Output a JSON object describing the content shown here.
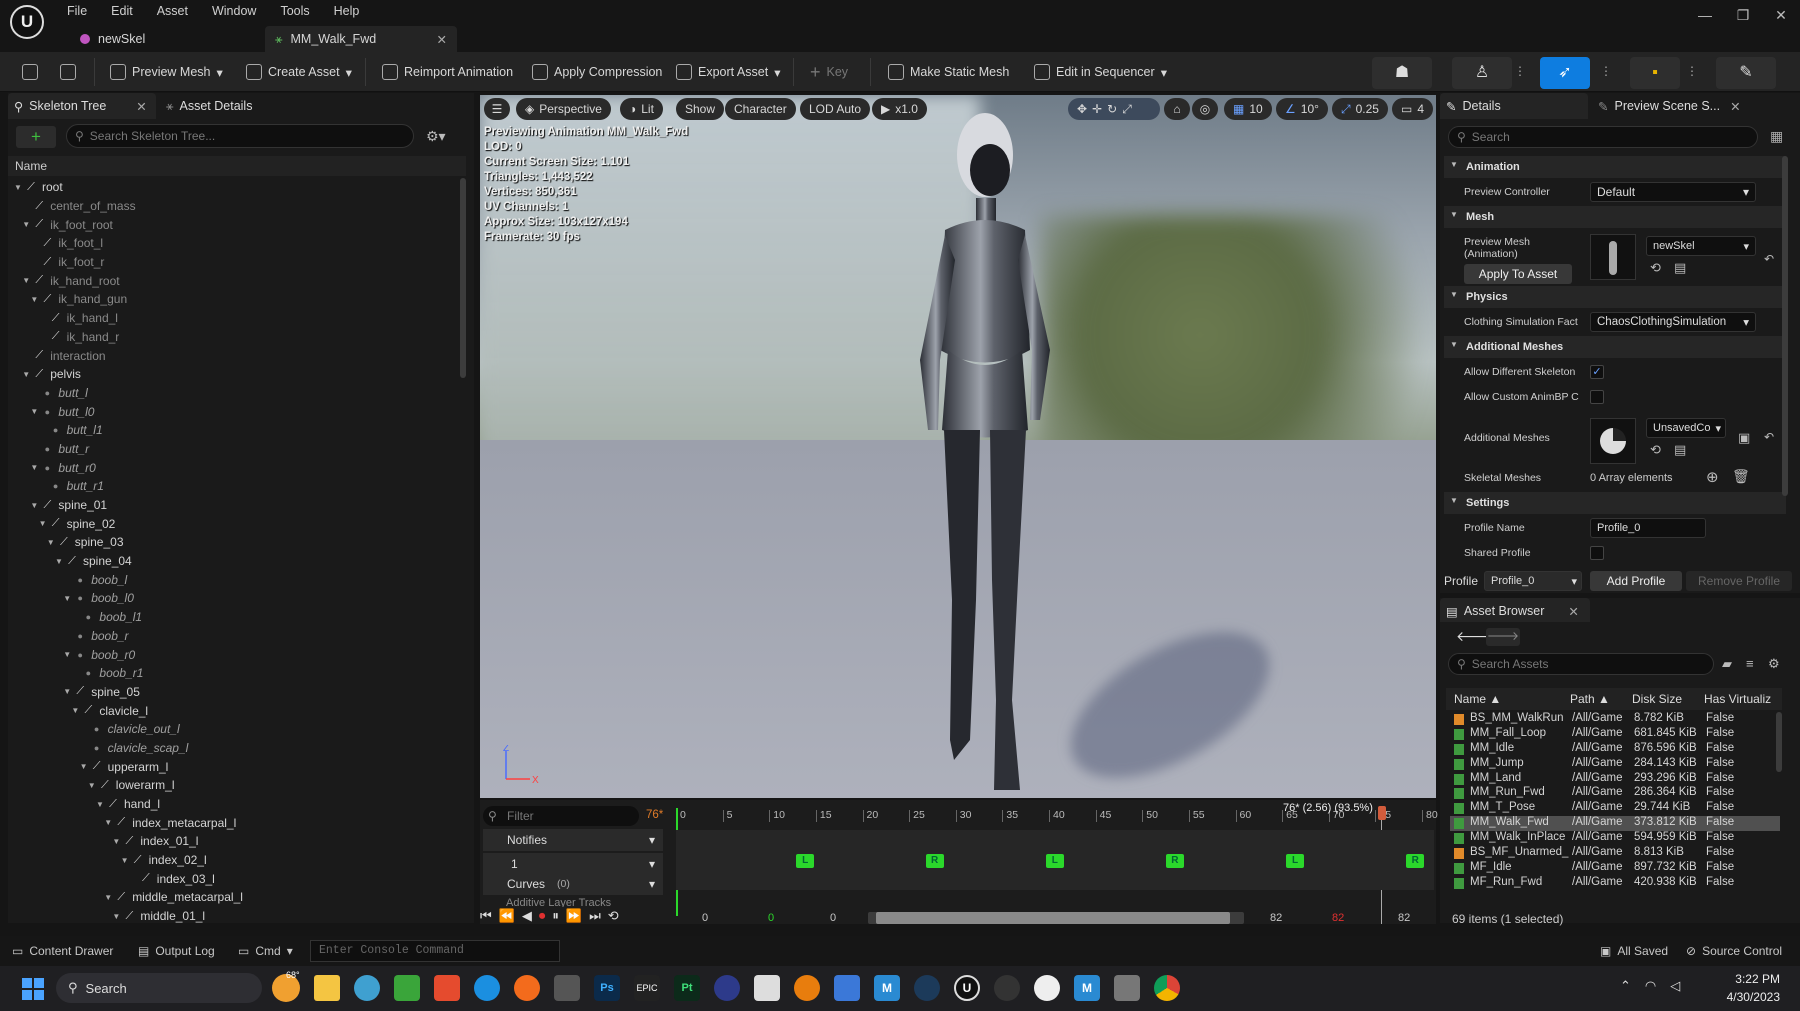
{
  "app": {
    "menus": [
      "File",
      "Edit",
      "Asset",
      "Window",
      "Tools",
      "Help"
    ],
    "tabs": [
      {
        "label": "newSkel"
      },
      {
        "label": "MM_Walk_Fwd"
      }
    ]
  },
  "toolbar": {
    "preview_mesh": "Preview Mesh",
    "create_asset": "Create Asset",
    "reimport": "Reimport Animation",
    "apply_compression": "Apply Compression",
    "export_asset": "Export Asset",
    "key": "Key",
    "make_static_mesh": "Make Static Mesh",
    "edit_in_sequencer": "Edit in Sequencer"
  },
  "left": {
    "tab_skeleton": "Skeleton Tree",
    "tab_asset_details": "Asset Details",
    "search_placeholder": "Search Skeleton Tree...",
    "name_header": "Name",
    "nodes": [
      {
        "label": "root",
        "depth": 0,
        "kind": "bone",
        "arrow": "▼"
      },
      {
        "label": "center_of_mass",
        "depth": 1,
        "kind": "bone",
        "dim": true
      },
      {
        "label": "ik_foot_root",
        "depth": 1,
        "kind": "bone",
        "arrow": "▼",
        "dim": true
      },
      {
        "label": "ik_foot_l",
        "depth": 2,
        "kind": "bone",
        "dim": true
      },
      {
        "label": "ik_foot_r",
        "depth": 2,
        "kind": "bone",
        "dim": true
      },
      {
        "label": "ik_hand_root",
        "depth": 1,
        "kind": "bone",
        "arrow": "▼",
        "dim": true
      },
      {
        "label": "ik_hand_gun",
        "depth": 2,
        "kind": "bone",
        "arrow": "▼",
        "dim": true
      },
      {
        "label": "ik_hand_l",
        "depth": 3,
        "kind": "bone",
        "dim": true
      },
      {
        "label": "ik_hand_r",
        "depth": 3,
        "kind": "bone",
        "dim": true
      },
      {
        "label": "interaction",
        "depth": 1,
        "kind": "bone",
        "dim": true
      },
      {
        "label": "pelvis",
        "depth": 1,
        "kind": "bone",
        "arrow": "▼"
      },
      {
        "label": "butt_l",
        "depth": 2,
        "kind": "socket"
      },
      {
        "label": "butt_l0",
        "depth": 2,
        "kind": "socket",
        "arrow": "▼"
      },
      {
        "label": "butt_l1",
        "depth": 3,
        "kind": "socket"
      },
      {
        "label": "butt_r",
        "depth": 2,
        "kind": "socket"
      },
      {
        "label": "butt_r0",
        "depth": 2,
        "kind": "socket",
        "arrow": "▼"
      },
      {
        "label": "butt_r1",
        "depth": 3,
        "kind": "socket"
      },
      {
        "label": "spine_01",
        "depth": 2,
        "kind": "bone",
        "arrow": "▼"
      },
      {
        "label": "spine_02",
        "depth": 3,
        "kind": "bone",
        "arrow": "▼"
      },
      {
        "label": "spine_03",
        "depth": 4,
        "kind": "bone",
        "arrow": "▼"
      },
      {
        "label": "spine_04",
        "depth": 5,
        "kind": "bone",
        "arrow": "▼"
      },
      {
        "label": "boob_l",
        "depth": 6,
        "kind": "socket"
      },
      {
        "label": "boob_l0",
        "depth": 6,
        "kind": "socket",
        "arrow": "▼"
      },
      {
        "label": "boob_l1",
        "depth": 7,
        "kind": "socket"
      },
      {
        "label": "boob_r",
        "depth": 6,
        "kind": "socket"
      },
      {
        "label": "boob_r0",
        "depth": 6,
        "kind": "socket",
        "arrow": "▼"
      },
      {
        "label": "boob_r1",
        "depth": 7,
        "kind": "socket"
      },
      {
        "label": "spine_05",
        "depth": 6,
        "kind": "bone",
        "arrow": "▼"
      },
      {
        "label": "clavicle_l",
        "depth": 7,
        "kind": "bone",
        "arrow": "▼"
      },
      {
        "label": "clavicle_out_l",
        "depth": 8,
        "kind": "socket"
      },
      {
        "label": "clavicle_scap_l",
        "depth": 8,
        "kind": "socket"
      },
      {
        "label": "upperarm_l",
        "depth": 8,
        "kind": "bone",
        "arrow": "▼"
      },
      {
        "label": "lowerarm_l",
        "depth": 9,
        "kind": "bone",
        "arrow": "▼"
      },
      {
        "label": "hand_l",
        "depth": 10,
        "kind": "bone",
        "arrow": "▼"
      },
      {
        "label": "index_metacarpal_l",
        "depth": 11,
        "kind": "bone",
        "arrow": "▼"
      },
      {
        "label": "index_01_l",
        "depth": 12,
        "kind": "bone",
        "arrow": "▼"
      },
      {
        "label": "index_02_l",
        "depth": 13,
        "kind": "bone",
        "arrow": "▼"
      },
      {
        "label": "index_03_l",
        "depth": 14,
        "kind": "bone"
      },
      {
        "label": "middle_metacarpal_l",
        "depth": 11,
        "kind": "bone",
        "arrow": "▼"
      },
      {
        "label": "middle_01_l",
        "depth": 12,
        "kind": "bone",
        "arrow": "▼"
      }
    ]
  },
  "viewport": {
    "perspective": "Perspective",
    "lit": "Lit",
    "show": "Show",
    "character": "Character",
    "lod": "LOD Auto",
    "speed": "x1.0",
    "grid": "10",
    "angle": "10°",
    "scale": "0.25",
    "cam": "4",
    "info": [
      "Previewing Animation MM_Walk_Fwd",
      "LOD: 0",
      "Current Screen Size: 1.101",
      "Triangles: 1,443,522",
      "Vertices: 850,361",
      "UV Channels: 1",
      "Approx Size: 103x127x194",
      "Framerate: 30 fps"
    ],
    "axis_z": "Z",
    "axis_x": "X"
  },
  "timeline": {
    "filter_placeholder": "Filter",
    "frame": "76*",
    "notifies": "Notifies",
    "track1": "1",
    "curves": "Curves",
    "curves_count": "(0)",
    "additive": "Additive Layer Tracks",
    "ruler": [
      "0",
      "5",
      "10",
      "15",
      "20",
      "25",
      "30",
      "35",
      "40",
      "45",
      "50",
      "55",
      "60",
      "65",
      "70",
      "75",
      "80"
    ],
    "current": "76* (2.56) (93.5%)",
    "notify_markers": [
      "L",
      "R",
      "L",
      "R",
      "L",
      "R"
    ],
    "range_start": "0",
    "range_start2": "0",
    "range_end": "82",
    "range_end2": "82",
    "range_mid": "0",
    "range_mid2": "82"
  },
  "details": {
    "tab_details": "Details",
    "tab_preview": "Preview Scene S...",
    "search_placeholder": "Search",
    "animation_section": "Animation",
    "preview_controller_label": "Preview Controller",
    "preview_controller_value": "Default",
    "mesh_section": "Mesh",
    "preview_mesh_label": "Preview Mesh (Animation)",
    "preview_mesh_value": "newSkel",
    "apply_to_asset": "Apply To Asset",
    "physics_section": "Physics",
    "clothing_label": "Clothing Simulation Fact",
    "clothing_value": "ChaosClothingSimulation",
    "additional_section": "Additional Meshes",
    "allow_diff_label": "Allow Different Skeleton",
    "allow_custom_label": "Allow Custom AnimBP C",
    "additional_meshes_label": "Additional Meshes",
    "additional_meshes_value": "UnsavedCo",
    "skeletal_meshes_label": "Skeletal Meshes",
    "skeletal_meshes_value": "0 Array elements",
    "settings_section": "Settings",
    "profile_name_label": "Profile Name",
    "profile_name_value": "Profile_0",
    "shared_profile_label": "Shared Profile",
    "profile_label": "Profile",
    "profile_value": "Profile_0",
    "add_profile": "Add Profile",
    "remove_profile": "Remove Profile"
  },
  "asset_browser": {
    "title": "Asset Browser",
    "search_placeholder": "Search Assets",
    "columns": [
      "Name",
      "Path",
      "Disk Size",
      "Has Virtualiz"
    ],
    "rows": [
      {
        "name": "BS_MM_WalkRun",
        "path": "/All/Game",
        "size": "8.782 KiB",
        "virt": "False",
        "type": "blendspace"
      },
      {
        "name": "MM_Fall_Loop",
        "path": "/All/Game",
        "size": "681.845 KiB",
        "virt": "False",
        "type": "anim"
      },
      {
        "name": "MM_Idle",
        "path": "/All/Game",
        "size": "876.596 KiB",
        "virt": "False",
        "type": "anim"
      },
      {
        "name": "MM_Jump",
        "path": "/All/Game",
        "size": "284.143 KiB",
        "virt": "False",
        "type": "anim"
      },
      {
        "name": "MM_Land",
        "path": "/All/Game",
        "size": "293.296 KiB",
        "virt": "False",
        "type": "anim"
      },
      {
        "name": "MM_Run_Fwd",
        "path": "/All/Game",
        "size": "286.364 KiB",
        "virt": "False",
        "type": "anim"
      },
      {
        "name": "MM_T_Pose",
        "path": "/All/Game",
        "size": "29.744 KiB",
        "virt": "False",
        "type": "anim"
      },
      {
        "name": "MM_Walk_Fwd",
        "path": "/All/Game",
        "size": "373.812 KiB",
        "virt": "False",
        "type": "anim",
        "selected": true
      },
      {
        "name": "MM_Walk_InPlace",
        "path": "/All/Game",
        "size": "594.959 KiB",
        "virt": "False",
        "type": "anim"
      },
      {
        "name": "BS_MF_Unarmed_",
        "path": "/All/Game",
        "size": "8.813 KiB",
        "virt": "False",
        "type": "blendspace"
      },
      {
        "name": "MF_Idle",
        "path": "/All/Game",
        "size": "897.732 KiB",
        "virt": "False",
        "type": "anim"
      },
      {
        "name": "MF_Run_Fwd",
        "path": "/All/Game",
        "size": "420.938 KiB",
        "virt": "False",
        "type": "anim"
      }
    ],
    "status": "69 items (1 selected)"
  },
  "statusbar": {
    "content_drawer": "Content Drawer",
    "output_log": "Output Log",
    "cmd": "Cmd",
    "console_placeholder": "Enter Console Command",
    "all_saved": "All Saved",
    "source_control": "Source Control"
  },
  "taskbar": {
    "search": "Search",
    "time": "3:22 PM",
    "date": "4/30/2023",
    "weather": "68°"
  },
  "colors": {
    "accent": "#0e7de0",
    "notify": "#2bd82b",
    "bg": "#1a1a1a"
  }
}
